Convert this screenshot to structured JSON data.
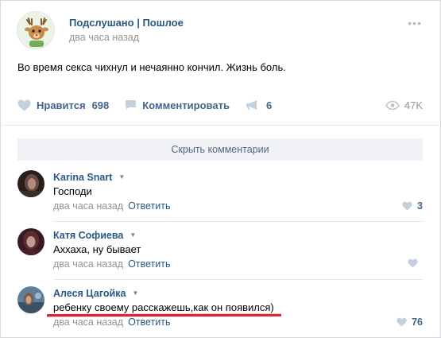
{
  "post": {
    "group_name": "Подслушано | Пошлое",
    "time": "два часа назад",
    "text": "Во время секса чихнул и нечаянно кончил. Жизнь боль.",
    "more_icon": "more-dots-icon"
  },
  "actions": {
    "like_label": "Нравится",
    "like_count": "698",
    "comment_label": "Комментировать",
    "share_count": "6",
    "views": "47K"
  },
  "comments_toggle": "Скрыть комментарии",
  "comments": [
    {
      "author": "Karina Snart",
      "text": "Господи",
      "time": "два часа назад",
      "reply": "Ответить",
      "likes": "3"
    },
    {
      "author": "Катя Софиева",
      "text": "Аххаха, ну бывает",
      "time": "два часа назад",
      "reply": "Ответить",
      "likes": ""
    },
    {
      "author": "Алеся Цагойка",
      "text": "ребенку своему расскажешь,как он появился)",
      "time": "два часа назад",
      "reply": "Ответить",
      "likes": "76"
    }
  ],
  "colors": {
    "link": "#2a5885",
    "action": "#42648b",
    "muted": "#939393",
    "underline": "#e0212d"
  }
}
